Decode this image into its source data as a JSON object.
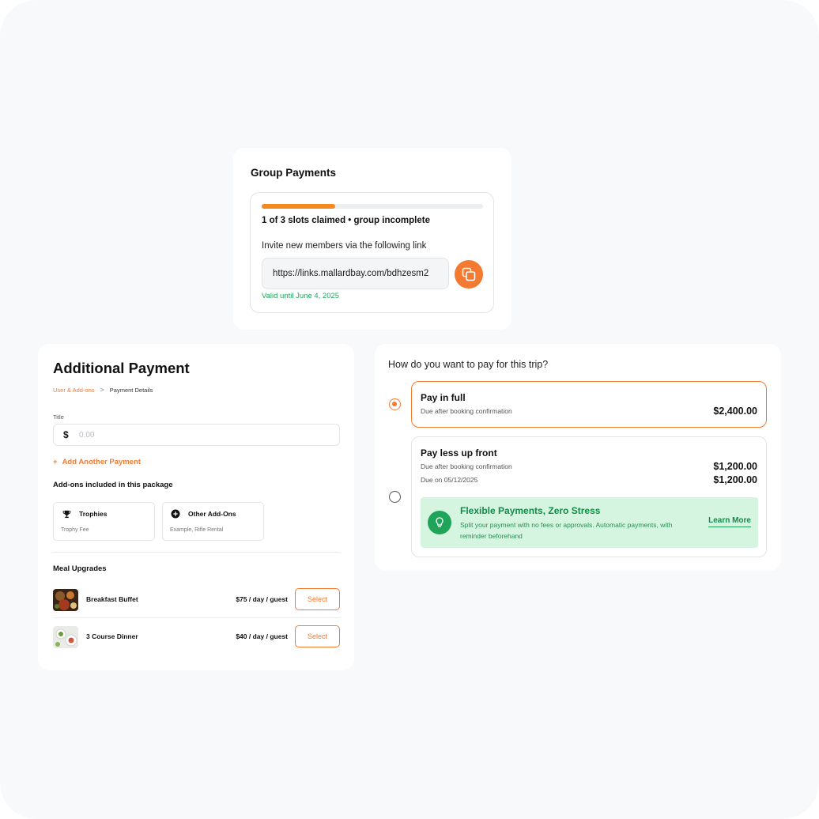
{
  "group_payments": {
    "title": "Group Payments",
    "progress_fraction": 0.333,
    "status": "1 of 3 slots claimed • group incomplete",
    "invite_text": "Invite new members via the following link",
    "link": "https://links.mallardbay.com/bdhzesm2",
    "valid_until": "Valid until June 4, 2025",
    "copy_icon": "copy-icon",
    "accent": "#f28b1d"
  },
  "additional_payment": {
    "title": "Additional Payment",
    "breadcrumb": [
      "User & Add-ons",
      "Payment Details"
    ],
    "breadcrumb_sep": ">",
    "field_label": "Title",
    "currency": "$",
    "amount_placeholder": "0.00",
    "add_payment": "Add Another Payment",
    "add_plus": "+",
    "addons_heading": "Add-ons included in this package",
    "addons": [
      {
        "title": "Trophies",
        "subtitle": "Trophy Fee",
        "icon": "trophy-icon"
      },
      {
        "title": "Other Add-Ons",
        "subtitle": "Example, Rifle Rental",
        "icon": "plus-circle-icon"
      }
    ],
    "meal_heading": "Meal Upgrades",
    "meals": [
      {
        "name": "Breakfast Buffet",
        "price": "$75 / day / guest",
        "button": "Select"
      },
      {
        "name": "3 Course Dinner",
        "price": "$40 / day / guest",
        "button": "Select"
      }
    ],
    "accent": "#f47a32"
  },
  "pay_options": {
    "question": "How do you want to pay for this trip?",
    "full": {
      "title": "Pay in full",
      "subtitle": "Due after booking confirmation",
      "amount": "$2,400.00",
      "selected": true
    },
    "partial": {
      "title": "Pay less up front",
      "line1": "Due after booking confirmation",
      "amount1": "$1,200.00",
      "line2": "Due on 05/12/2025",
      "amount2": "$1,200.00",
      "selected": false
    },
    "flex": {
      "title": "Flexible Payments, Zero Stress",
      "desc": "Split your payment with no fees or approvals. Automatic payments, with reminder beforehand",
      "learn_more": "Learn More",
      "icon": "lightbulb-icon",
      "bg": "#d6f5e1",
      "green": "#1fa45a"
    }
  }
}
